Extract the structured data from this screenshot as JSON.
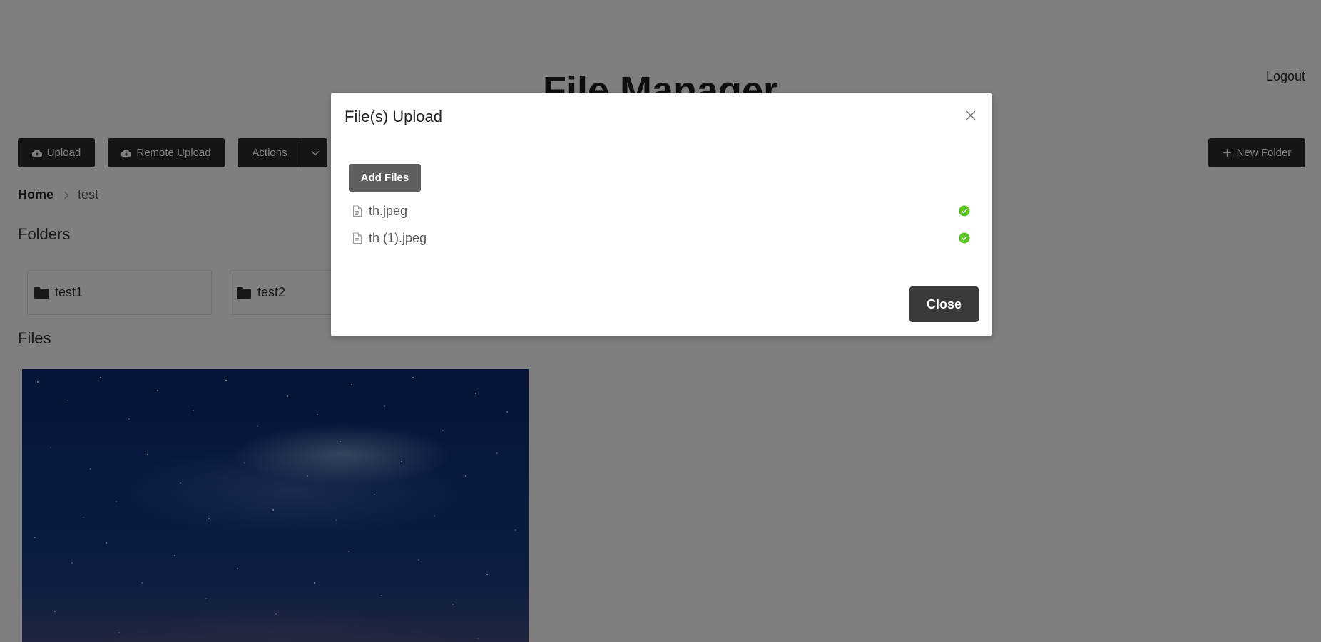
{
  "header": {
    "title": "File Manager",
    "logout_label": "Logout"
  },
  "toolbar": {
    "upload_label": "Upload",
    "remote_upload_label": "Remote Upload",
    "actions_label": "Actions",
    "new_folder_label": "New Folder"
  },
  "breadcrumb": {
    "home": "Home",
    "current": "test"
  },
  "folders": {
    "heading": "Folders",
    "items": [
      {
        "name": "test1"
      },
      {
        "name": "test2"
      }
    ]
  },
  "files": {
    "heading": "Files"
  },
  "upload_modal": {
    "title": "File(s) Upload",
    "add_files_label": "Add Files",
    "close_label": "Close",
    "files": [
      {
        "name": "th.jpeg",
        "status_icon": "check-circle-icon"
      },
      {
        "name": "th (1).jpeg",
        "status_icon": "check-circle-icon"
      }
    ]
  },
  "colors": {
    "button_dark": "#2b2b2b",
    "success_green": "#52c41a",
    "overlay": "rgba(0,0,0,0.5)"
  }
}
